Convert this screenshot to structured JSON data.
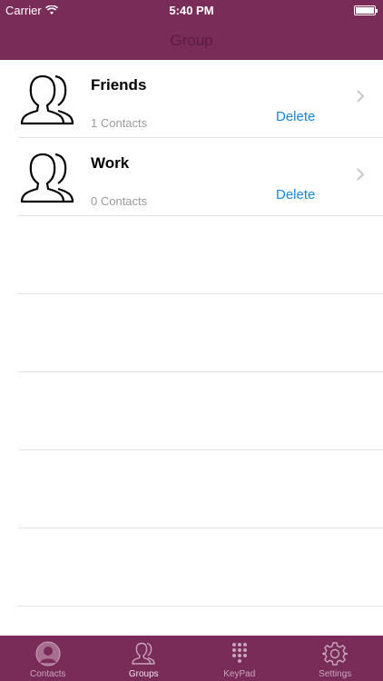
{
  "status_bar": {
    "carrier": "Carrier",
    "time": "5:40 PM"
  },
  "nav": {
    "title": "Group"
  },
  "groups": [
    {
      "name": "Friends",
      "count_label": "1 Contacts",
      "delete_label": "Delete"
    },
    {
      "name": "Work",
      "count_label": "0 Contacts",
      "delete_label": "Delete"
    }
  ],
  "tabs": [
    {
      "label": "Contacts",
      "icon": "person-icon"
    },
    {
      "label": "Groups",
      "icon": "group-icon",
      "active": true
    },
    {
      "label": "KeyPad",
      "icon": "keypad-icon"
    },
    {
      "label": "Settings",
      "icon": "gear-icon"
    }
  ],
  "colors": {
    "brand": "#7a2c59",
    "link": "#1a86d8"
  }
}
